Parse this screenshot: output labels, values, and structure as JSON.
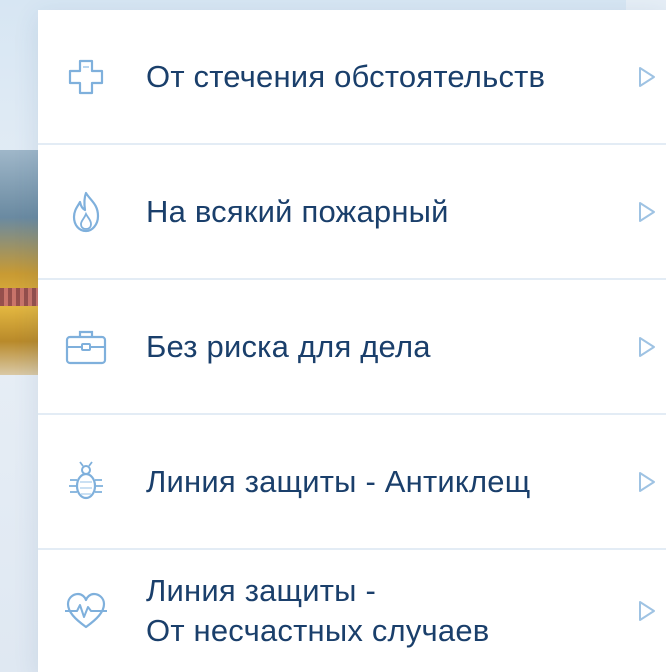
{
  "menu": {
    "items": [
      {
        "id": "circumstances",
        "icon": "medical-cross-icon",
        "lines": [
          "От стечения обстоятельств"
        ]
      },
      {
        "id": "fire",
        "icon": "flame-icon",
        "lines": [
          "На всякий пожарный"
        ]
      },
      {
        "id": "business",
        "icon": "briefcase-icon",
        "lines": [
          "Без риска для дела"
        ]
      },
      {
        "id": "tick",
        "icon": "tick-bug-icon",
        "lines": [
          "Линия защиты - Антиклещ"
        ]
      },
      {
        "id": "accident",
        "icon": "heart-pulse-icon",
        "lines": [
          "Линия защиты -",
          "От несчастных случаев"
        ]
      }
    ]
  },
  "colors": {
    "text": "#1a3f6b",
    "icon": "#7fb0dc",
    "divider": "#e3ecf5",
    "arrow": "#9fc3e3"
  }
}
